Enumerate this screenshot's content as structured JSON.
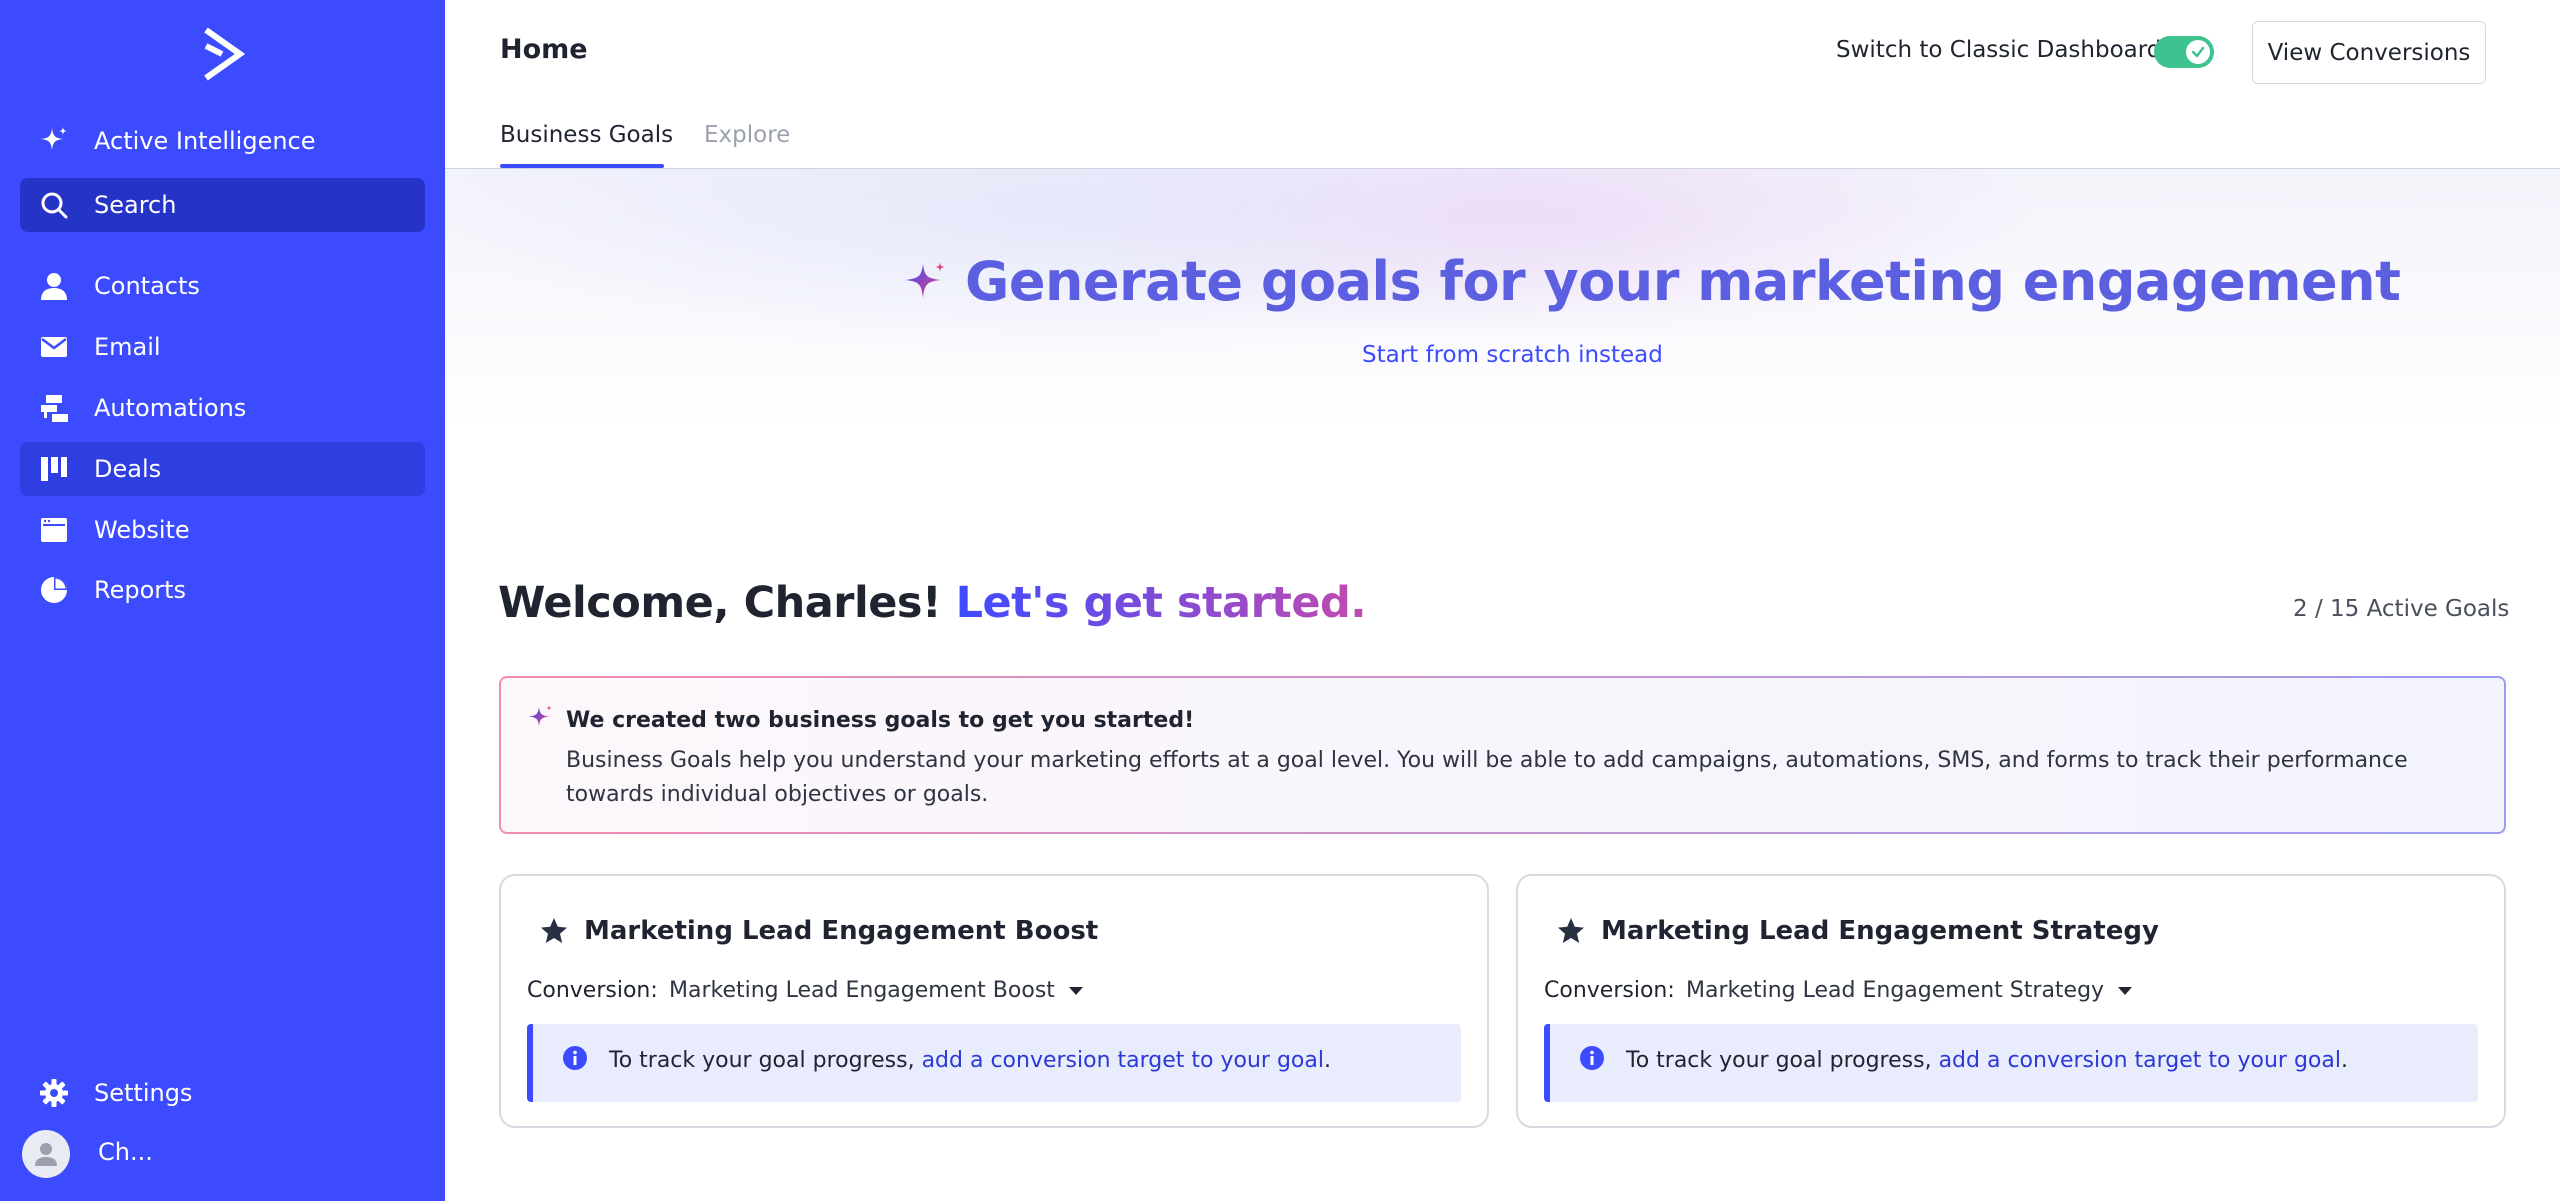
{
  "sidebar": {
    "logo_icon": "activecampaign-chevron-logo",
    "items": [
      {
        "label": "Active Intelligence",
        "icon": "sparkle-icon"
      },
      {
        "label": "Search",
        "icon": "search-icon"
      },
      {
        "label": "Contacts",
        "icon": "person-icon"
      },
      {
        "label": "Email",
        "icon": "envelope-icon"
      },
      {
        "label": "Automations",
        "icon": "automations-icon"
      },
      {
        "label": "Deals",
        "icon": "deals-icon"
      },
      {
        "label": "Website",
        "icon": "website-icon"
      },
      {
        "label": "Reports",
        "icon": "pie-chart-icon"
      }
    ],
    "settings_label": "Settings",
    "user_name": "Ch..."
  },
  "header": {
    "title": "Home",
    "switch_label": "Switch to Classic Dashboard",
    "switch_on": true,
    "view_conversions_label": "View Conversions",
    "tabs": [
      {
        "label": "Business Goals",
        "active": true
      },
      {
        "label": "Explore",
        "active": false
      }
    ]
  },
  "hero": {
    "title": "Generate goals for your marketing engagement",
    "link": "Start from scratch instead"
  },
  "welcome": {
    "greeting": "Welcome, Charles!",
    "cta": "Let's get started.",
    "goals_count": "2 / 15 Active Goals"
  },
  "banner": {
    "title": "We created two business goals to get you started!",
    "text": "Business Goals help you understand your marketing efforts at a goal level. You will be able to add campaigns, automations, SMS, and forms to track their performance towards individual objectives or goals."
  },
  "goals": [
    {
      "title": "Marketing Lead Engagement Boost",
      "conversion_label": "Conversion:",
      "conversion_value": "Marketing Lead Engagement Boost",
      "info_text": "To track your goal progress, ",
      "info_link": "add a conversion target to your goal",
      "info_end": "."
    },
    {
      "title": "Marketing Lead Engagement Strategy",
      "conversion_label": "Conversion:",
      "conversion_value": "Marketing Lead Engagement Strategy",
      "info_text": "To track your goal progress, ",
      "info_link": "add a conversion target to your goal",
      "info_end": "."
    }
  ],
  "colors": {
    "sidebar_bg": "#3d4bff",
    "accent": "#3d4bff",
    "toggle_on": "#3ec28f",
    "hero_title": "#5b5fe0"
  }
}
